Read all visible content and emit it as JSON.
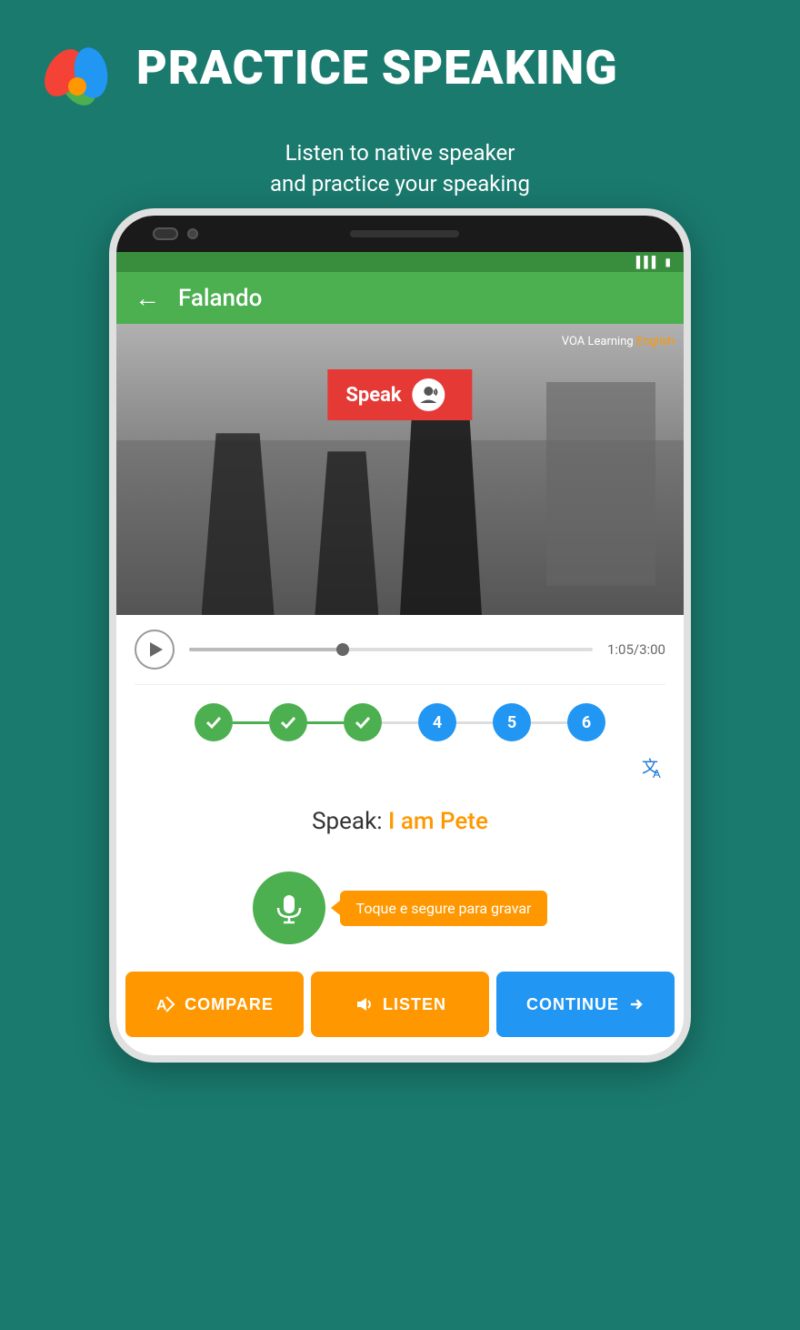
{
  "header": {
    "title": "PRACTICE SPEAKING",
    "subtitle_line1": "Listen to native speaker",
    "subtitle_line2": "and practice your speaking"
  },
  "appbar": {
    "title": "Falando",
    "back_label": "←"
  },
  "video": {
    "speak_label": "Speak",
    "brand": "VOA Learning",
    "brand_colored": "English"
  },
  "player": {
    "current_time": "1:05",
    "total_time": "3:00",
    "time_display": "1:05/3:00",
    "progress_percent": 38
  },
  "steps": [
    {
      "type": "check",
      "label": "✓"
    },
    {
      "type": "check",
      "label": "✓"
    },
    {
      "type": "check",
      "label": "✓"
    },
    {
      "type": "number",
      "label": "4"
    },
    {
      "type": "number",
      "label": "5"
    },
    {
      "type": "number",
      "label": "6"
    }
  ],
  "phrase": {
    "prefix": "Speak: ",
    "text": "I am Pete"
  },
  "mic": {
    "tooltip": "Toque e segure para gravar"
  },
  "buttons": {
    "compare": "COMPARE",
    "listen": "LISTEN",
    "continue": "CONTINUE"
  },
  "colors": {
    "green": "#4caf50",
    "orange": "#ff9800",
    "blue": "#2196f3",
    "dark_green": "#1a7a6e"
  }
}
